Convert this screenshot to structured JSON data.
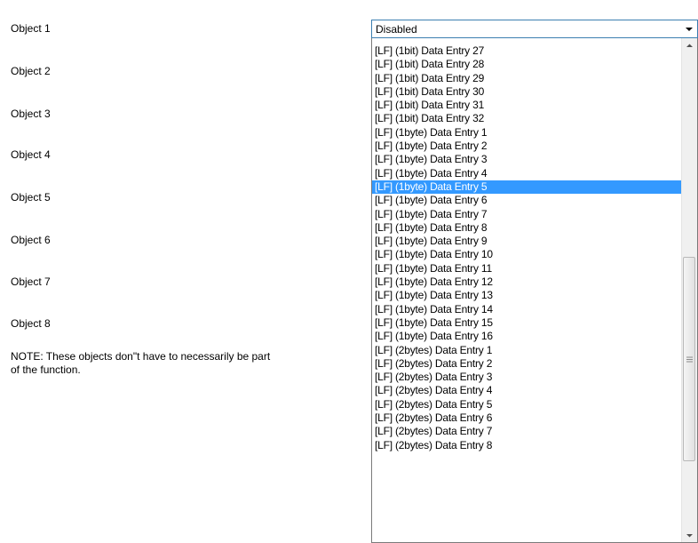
{
  "objects": [
    {
      "label": "Object 1"
    },
    {
      "label": "Object 2"
    },
    {
      "label": "Object 3"
    },
    {
      "label": "Object 4"
    },
    {
      "label": "Object 5"
    },
    {
      "label": "Object 6"
    },
    {
      "label": "Object 7"
    },
    {
      "label": "Object 8"
    }
  ],
  "note": "NOTE: These objects don\"t have to necessarily be part of the function.",
  "combo": {
    "value": "Disabled",
    "arrow_icon": "chevron-down-icon"
  },
  "dropdown": {
    "selected_index": 10,
    "items": [
      "[LF] (1bit) Data Entry 27",
      "[LF] (1bit) Data Entry 28",
      "[LF] (1bit) Data Entry 29",
      "[LF] (1bit) Data Entry 30",
      "[LF] (1bit) Data Entry 31",
      "[LF] (1bit) Data Entry 32",
      "[LF] (1byte) Data Entry 1",
      "[LF] (1byte) Data Entry 2",
      "[LF] (1byte) Data Entry 3",
      "[LF] (1byte) Data Entry 4",
      "[LF] (1byte) Data Entry 5",
      "[LF] (1byte) Data Entry 6",
      "[LF] (1byte) Data Entry 7",
      "[LF] (1byte) Data Entry 8",
      "[LF] (1byte) Data Entry 9",
      "[LF] (1byte) Data Entry 10",
      "[LF] (1byte) Data Entry 11",
      "[LF] (1byte) Data Entry 12",
      "[LF] (1byte) Data Entry 13",
      "[LF] (1byte) Data Entry 14",
      "[LF] (1byte) Data Entry 15",
      "[LF] (1byte) Data Entry 16",
      "[LF] (2bytes) Data Entry 1",
      "[LF] (2bytes) Data Entry 2",
      "[LF] (2bytes) Data Entry 3",
      "[LF] (2bytes) Data Entry 4",
      "[LF] (2bytes) Data Entry 5",
      "[LF] (2bytes) Data Entry 6",
      "[LF] (2bytes) Data Entry 7",
      "[LF] (2bytes) Data Entry 8"
    ]
  },
  "colors": {
    "selection": "#3399ff",
    "combo_border": "#3c7fb1"
  }
}
